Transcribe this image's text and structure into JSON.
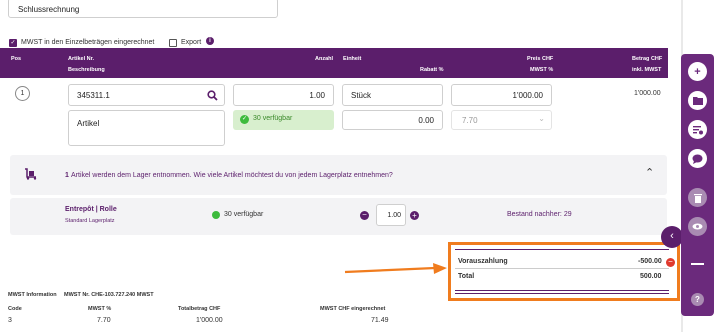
{
  "doc": {
    "title_value": "Schlussrechnung"
  },
  "options": {
    "mwst_label": "MWST in den Einzelbeträgen eingerechnet",
    "export_label": "Export",
    "info_glyph": "i"
  },
  "table": {
    "headers": {
      "pos": "Pos",
      "artikel_nr": "Artikel Nr.",
      "beschreibung": "Beschreibung",
      "anzahl": "Anzahl",
      "einheit": "Einheit",
      "rabatt": "Rabatt %",
      "preis": "Preis CHF",
      "mwst": "MWST %",
      "betrag": "Betrag CHF",
      "inkl": "inkl. MWST"
    }
  },
  "row": {
    "pos": "1",
    "artikel_nr": "345311.1",
    "beschreibung": "Artikel",
    "anzahl": "1.00",
    "einheit": "Stück",
    "rabatt": "0.00",
    "preis": "1'000.00",
    "mwst": "7.70",
    "availability": "30 verfügbar",
    "betrag": "1'000.00"
  },
  "lager": {
    "count": "1",
    "message": "Artikel werden dem Lager entnommen. Wie viele Artikel möchtest du von jedem Lagerplatz entnehmen?",
    "location_name": "Entrepôt | Rolle",
    "location_type": "Standard Lagerplatz",
    "availability": "30 verfügbar",
    "quantity": "1.00",
    "bestand": "Bestand nachher: 29"
  },
  "summary": {
    "vorauszahlung_label": "Vorauszahlung",
    "vorauszahlung_value": "-500.00",
    "total_label": "Total",
    "total_value": "500.00"
  },
  "mwst_info": {
    "title": "MWST Information",
    "number": "MWST Nr. CHE-103.727.240 MWST",
    "headers": [
      "Code",
      "MWST %",
      "Totalbetrag CHF",
      "MWST CHF eingerechnet"
    ],
    "values": [
      "3",
      "7.70",
      "1'000.00",
      "71.49"
    ]
  },
  "sidebar": {
    "icons": [
      "plus-icon",
      "folder-icon",
      "list-settings-icon",
      "chat-icon",
      "trash-icon",
      "eye-icon",
      "minus-icon",
      "help-icon"
    ]
  },
  "colors": {
    "brand": "#5b1e6b",
    "highlight": "#f07c1e",
    "success": "#3dbb3d",
    "danger": "#e0392e"
  }
}
